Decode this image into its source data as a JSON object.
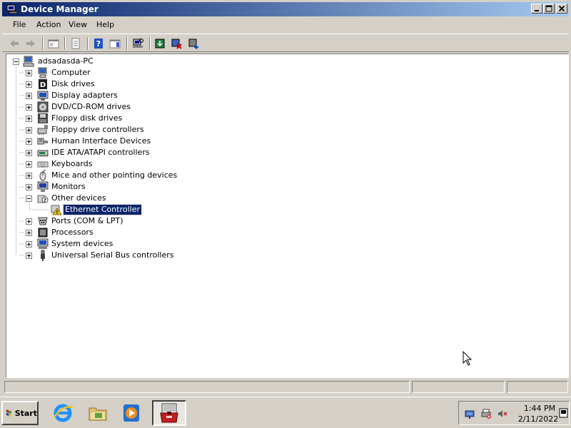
{
  "window": {
    "title": "Device Manager",
    "icon": "device-manager-icon"
  },
  "menubar": {
    "items": [
      "File",
      "Action",
      "View",
      "Help"
    ]
  },
  "toolbar": {
    "buttons": [
      "back-icon",
      "forward-icon",
      "show-hide-console-tree-icon",
      "properties-icon",
      "help-icon",
      "action-pane-icon",
      "scan-hardware-icon",
      "update-driver-icon",
      "uninstall-icon",
      "disable-icon"
    ]
  },
  "tree": {
    "root": "adsadasda-PC",
    "items": [
      {
        "label": "Computer",
        "icon": "computer-icon",
        "expanded": false
      },
      {
        "label": "Disk drives",
        "icon": "disk-drive-icon",
        "expanded": false
      },
      {
        "label": "Display adapters",
        "icon": "display-adapter-icon",
        "expanded": false
      },
      {
        "label": "DVD/CD-ROM drives",
        "icon": "dvd-icon",
        "expanded": false
      },
      {
        "label": "Floppy disk drives",
        "icon": "floppy-disk-icon",
        "expanded": false
      },
      {
        "label": "Floppy drive controllers",
        "icon": "floppy-controller-icon",
        "expanded": false
      },
      {
        "label": "Human Interface Devices",
        "icon": "hid-icon",
        "expanded": false
      },
      {
        "label": "IDE ATA/ATAPI controllers",
        "icon": "ide-controller-icon",
        "expanded": false
      },
      {
        "label": "Keyboards",
        "icon": "keyboard-icon",
        "expanded": false
      },
      {
        "label": "Mice and other pointing devices",
        "icon": "mouse-icon",
        "expanded": false
      },
      {
        "label": "Monitors",
        "icon": "monitor-icon",
        "expanded": false
      },
      {
        "label": "Other devices",
        "icon": "other-devices-icon",
        "expanded": true,
        "children": [
          {
            "label": "Ethernet Controller",
            "icon": "warning-device-icon",
            "selected": true
          }
        ]
      },
      {
        "label": "Ports (COM & LPT)",
        "icon": "port-icon",
        "expanded": false
      },
      {
        "label": "Processors",
        "icon": "processor-icon",
        "expanded": false
      },
      {
        "label": "System devices",
        "icon": "system-device-icon",
        "expanded": false
      },
      {
        "label": "Universal Serial Bus controllers",
        "icon": "usb-icon",
        "expanded": false
      }
    ]
  },
  "taskbar": {
    "start_label": "Start",
    "pinned": [
      "internet-explorer-icon",
      "windows-explorer-icon",
      "media-player-icon",
      "server-manager-icon"
    ],
    "tray": [
      "network-icon",
      "printer-icon",
      "volume-muted-icon"
    ],
    "clock_time": "1:44 PM",
    "clock_date": "2/11/2022"
  },
  "colors": {
    "titlebar_start": "#0a246a",
    "titlebar_end": "#a6caf0",
    "selection": "#0a246a",
    "face": "#d4d0c8"
  }
}
